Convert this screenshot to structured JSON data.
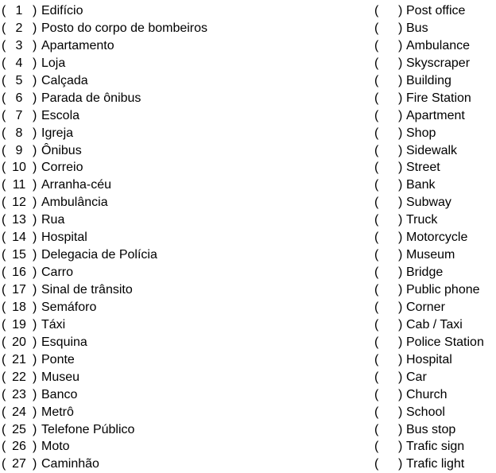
{
  "left_column": {
    "items": [
      {
        "number": "1",
        "label": "Edifício"
      },
      {
        "number": "2",
        "label": "Posto do corpo de bombeiros"
      },
      {
        "number": "3",
        "label": "Apartamento"
      },
      {
        "number": "4",
        "label": "Loja"
      },
      {
        "number": "5",
        "label": "Calçada"
      },
      {
        "number": "6",
        "label": "Parada de ônibus"
      },
      {
        "number": "7",
        "label": "Escola"
      },
      {
        "number": "8",
        "label": "Igreja"
      },
      {
        "number": "9",
        "label": "Ônibus"
      },
      {
        "number": "10",
        "label": "Correio"
      },
      {
        "number": "11",
        "label": "Arranha-céu"
      },
      {
        "number": "12",
        "label": "Ambulância"
      },
      {
        "number": "13",
        "label": "Rua"
      },
      {
        "number": "14",
        "label": "Hospital"
      },
      {
        "number": "15",
        "label": "Delegacia de Polícia"
      },
      {
        "number": "16",
        "label": "Carro"
      },
      {
        "number": "17",
        "label": "Sinal de trânsito"
      },
      {
        "number": "18",
        "label": "Semáforo"
      },
      {
        "number": "19",
        "label": "Táxi"
      },
      {
        "number": "20",
        "label": "Esquina"
      },
      {
        "number": "21",
        "label": "Ponte"
      },
      {
        "number": "22",
        "label": "Museu"
      },
      {
        "number": "23",
        "label": "Banco"
      },
      {
        "number": "24",
        "label": "Metrô"
      },
      {
        "number": "25",
        "label": "Telefone Público"
      },
      {
        "number": "26",
        "label": "Moto"
      },
      {
        "number": "27",
        "label": "Caminhão"
      }
    ]
  },
  "right_column": {
    "items": [
      {
        "answer": "",
        "label": "Post office"
      },
      {
        "answer": "",
        "label": "Bus"
      },
      {
        "answer": "",
        "label": "Ambulance"
      },
      {
        "answer": "",
        "label": "Skyscraper"
      },
      {
        "answer": "",
        "label": "Building"
      },
      {
        "answer": "",
        "label": "Fire Station"
      },
      {
        "answer": "",
        "label": "Apartment"
      },
      {
        "answer": "",
        "label": "Shop"
      },
      {
        "answer": "",
        "label": "Sidewalk"
      },
      {
        "answer": "",
        "label": "Street"
      },
      {
        "answer": "",
        "label": "Bank"
      },
      {
        "answer": "",
        "label": "Subway"
      },
      {
        "answer": "",
        "label": "Truck"
      },
      {
        "answer": "",
        "label": "Motorcycle"
      },
      {
        "answer": "",
        "label": "Museum"
      },
      {
        "answer": "",
        "label": "Bridge"
      },
      {
        "answer": "",
        "label": "Public phone"
      },
      {
        "answer": "",
        "label": "Corner"
      },
      {
        "answer": "",
        "label": "Cab / Taxi"
      },
      {
        "answer": "",
        "label": "Police Station"
      },
      {
        "answer": "",
        "label": "Hospital"
      },
      {
        "answer": "",
        "label": "Car"
      },
      {
        "answer": "",
        "label": "Church"
      },
      {
        "answer": "",
        "label": "School"
      },
      {
        "answer": "",
        "label": "Bus stop"
      },
      {
        "answer": "",
        "label": "Trafic sign"
      },
      {
        "answer": "",
        "label": "Trafic light"
      }
    ]
  },
  "symbols": {
    "open_paren": "(",
    "close_paren": ")"
  }
}
